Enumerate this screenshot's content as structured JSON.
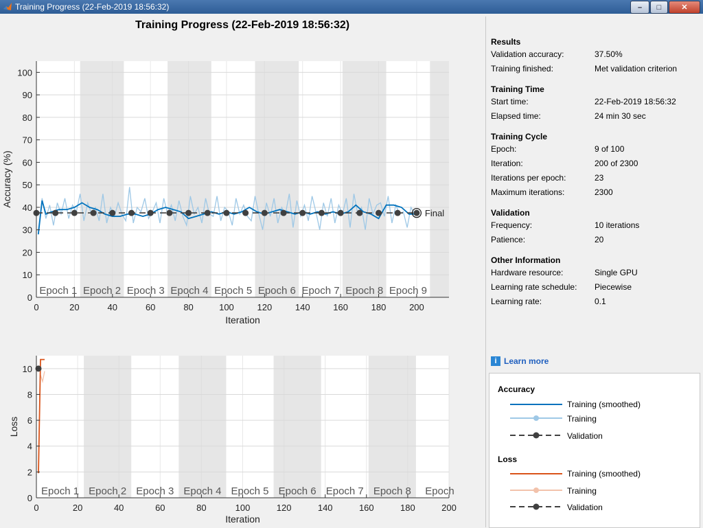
{
  "window": {
    "title": "Training Progress (22-Feb-2019 18:56:32)",
    "buttons": {
      "minimize": "–",
      "maximize": "□",
      "close": "✕"
    }
  },
  "main_title": "Training Progress (22-Feb-2019 18:56:32)",
  "colors": {
    "accuracy_smoothed": "#0072bd",
    "accuracy_training": "#9ec8e6",
    "validation": "#404040",
    "loss_smoothed": "#d95319",
    "loss_training": "#f2c2ab",
    "epoch_band": "#e6e6e6"
  },
  "chart_data": [
    {
      "type": "line",
      "title": "",
      "xlabel": "Iteration",
      "ylabel": "Accuracy (%)",
      "xlim": [
        0,
        217
      ],
      "ylim": [
        0,
        105
      ],
      "xticks": [
        0,
        20,
        40,
        60,
        80,
        100,
        120,
        140,
        160,
        180,
        200
      ],
      "yticks": [
        0,
        10,
        20,
        30,
        40,
        50,
        60,
        70,
        80,
        90,
        100
      ],
      "epoch_labels": [
        "Epoch 1",
        "Epoch 2",
        "Epoch 3",
        "Epoch 4",
        "Epoch 5",
        "Epoch 6",
        "Epoch 7",
        "Epoch 8",
        "Epoch 9"
      ],
      "iterations_per_epoch": 23,
      "final_label": "Final",
      "series": [
        {
          "name": "Training (smoothed)",
          "x": [
            1,
            3,
            5,
            8,
            12,
            16,
            20,
            24,
            28,
            32,
            36,
            40,
            44,
            48,
            52,
            56,
            60,
            64,
            68,
            72,
            76,
            80,
            84,
            88,
            92,
            96,
            100,
            104,
            108,
            112,
            116,
            120,
            124,
            128,
            132,
            136,
            140,
            144,
            148,
            152,
            156,
            160,
            164,
            168,
            172,
            176,
            180,
            184,
            188,
            192,
            196,
            200
          ],
          "values": [
            28,
            43,
            37,
            38,
            39,
            39,
            40,
            42,
            40,
            39,
            37,
            36,
            36,
            37,
            37,
            36,
            37,
            39,
            40,
            39,
            38,
            35,
            36,
            37,
            38,
            37,
            38,
            37,
            38,
            40,
            38,
            37,
            38,
            39,
            38,
            37,
            38,
            37,
            38,
            37,
            38,
            37,
            38,
            41,
            38,
            37,
            35,
            41,
            41,
            40,
            37,
            37
          ]
        },
        {
          "name": "Training",
          "x": [
            1,
            3,
            5,
            7,
            9,
            11,
            13,
            15,
            17,
            19,
            21,
            23,
            25,
            27,
            29,
            31,
            33,
            35,
            37,
            39,
            41,
            43,
            45,
            47,
            49,
            51,
            53,
            55,
            57,
            59,
            61,
            63,
            65,
            67,
            69,
            71,
            73,
            75,
            77,
            79,
            81,
            83,
            85,
            87,
            89,
            91,
            93,
            95,
            97,
            99,
            101,
            103,
            105,
            107,
            109,
            111,
            113,
            115,
            117,
            119,
            121,
            123,
            125,
            127,
            129,
            131,
            133,
            135,
            137,
            139,
            141,
            143,
            145,
            147,
            149,
            151,
            153,
            155,
            157,
            159,
            161,
            163,
            165,
            167,
            169,
            171,
            173,
            175,
            177,
            179,
            181,
            183,
            185,
            187,
            189,
            191,
            193,
            195,
            197,
            199
          ],
          "values": [
            30,
            44,
            35,
            41,
            32,
            42,
            37,
            44,
            35,
            41,
            38,
            46,
            34,
            42,
            37,
            40,
            34,
            46,
            33,
            40,
            36,
            42,
            37,
            34,
            49,
            33,
            40,
            38,
            44,
            35,
            38,
            42,
            33,
            44,
            37,
            41,
            34,
            43,
            36,
            32,
            45,
            37,
            40,
            33,
            44,
            37,
            36,
            45,
            34,
            40,
            38,
            32,
            44,
            37,
            41,
            36,
            34,
            45,
            37,
            30,
            42,
            36,
            44,
            33,
            40,
            37,
            46,
            31,
            43,
            36,
            41,
            34,
            45,
            38,
            30,
            42,
            36,
            44,
            33,
            41,
            37,
            44,
            31,
            46,
            37,
            40,
            30,
            44,
            37,
            41,
            42,
            36,
            45,
            33,
            41,
            37,
            38,
            31,
            40,
            37
          ]
        },
        {
          "name": "Validation",
          "x": [
            0,
            10,
            20,
            30,
            40,
            50,
            60,
            70,
            80,
            90,
            100,
            110,
            120,
            130,
            140,
            150,
            160,
            170,
            180,
            190,
            200
          ],
          "values": [
            37.5,
            37.5,
            37.5,
            37.5,
            37.5,
            37.5,
            37.5,
            37.5,
            37.5,
            37.5,
            37.5,
            37.5,
            37.5,
            37.5,
            37.5,
            37.5,
            37.5,
            37.5,
            37.5,
            37.5,
            37.5
          ]
        }
      ]
    },
    {
      "type": "line",
      "title": "",
      "xlabel": "Iteration",
      "ylabel": "Loss",
      "xlim": [
        0,
        200
      ],
      "ylim": [
        0,
        11
      ],
      "xticks": [
        0,
        20,
        40,
        60,
        80,
        100,
        120,
        140,
        160,
        180,
        200
      ],
      "yticks": [
        0,
        2,
        4,
        6,
        8,
        10
      ],
      "epoch_labels": [
        "Epoch 1",
        "Epoch 2",
        "Epoch 3",
        "Epoch 4",
        "Epoch 5",
        "Epoch 6",
        "Epoch 7",
        "Epoch 8",
        "Epoch"
      ],
      "iterations_per_epoch": 23,
      "series": [
        {
          "name": "Training (smoothed)",
          "x": [
            1,
            2,
            3,
            4
          ],
          "values": [
            1.9,
            10.7,
            10.7,
            10.7
          ]
        },
        {
          "name": "Training",
          "x": [
            2,
            3,
            4
          ],
          "values": [
            9.5,
            9.0,
            9.8
          ]
        },
        {
          "name": "Validation",
          "x": [
            1
          ],
          "values": [
            10
          ]
        }
      ]
    }
  ],
  "info": {
    "sections": [
      {
        "title": "Results",
        "rows": [
          {
            "key": "Validation accuracy:",
            "value": "37.50%"
          },
          {
            "key": "Training finished:",
            "value": "Met validation criterion"
          }
        ]
      },
      {
        "title": "Training Time",
        "rows": [
          {
            "key": "Start time:",
            "value": "22-Feb-2019 18:56:32"
          },
          {
            "key": "Elapsed time:",
            "value": "24 min 30 sec"
          }
        ]
      },
      {
        "title": "Training Cycle",
        "rows": [
          {
            "key": "Epoch:",
            "value": "9 of 100"
          },
          {
            "key": "Iteration:",
            "value": "200 of 2300"
          },
          {
            "key": "Iterations per epoch:",
            "value": "23"
          },
          {
            "key": "Maximum iterations:",
            "value": "2300"
          }
        ]
      },
      {
        "title": "Validation",
        "rows": [
          {
            "key": "Frequency:",
            "value": "10 iterations"
          },
          {
            "key": "Patience:",
            "value": "20"
          }
        ]
      },
      {
        "title": "Other Information",
        "rows": [
          {
            "key": "Hardware resource:",
            "value": "Single GPU"
          },
          {
            "key": "Learning rate schedule:",
            "value": "Piecewise"
          },
          {
            "key": "Learning rate:",
            "value": "0.1"
          }
        ]
      }
    ],
    "learn_more": "Learn more"
  },
  "legend": {
    "accuracy_title": "Accuracy",
    "loss_title": "Loss",
    "items": {
      "smoothed": "Training (smoothed)",
      "training": "Training",
      "validation": "Validation"
    }
  }
}
